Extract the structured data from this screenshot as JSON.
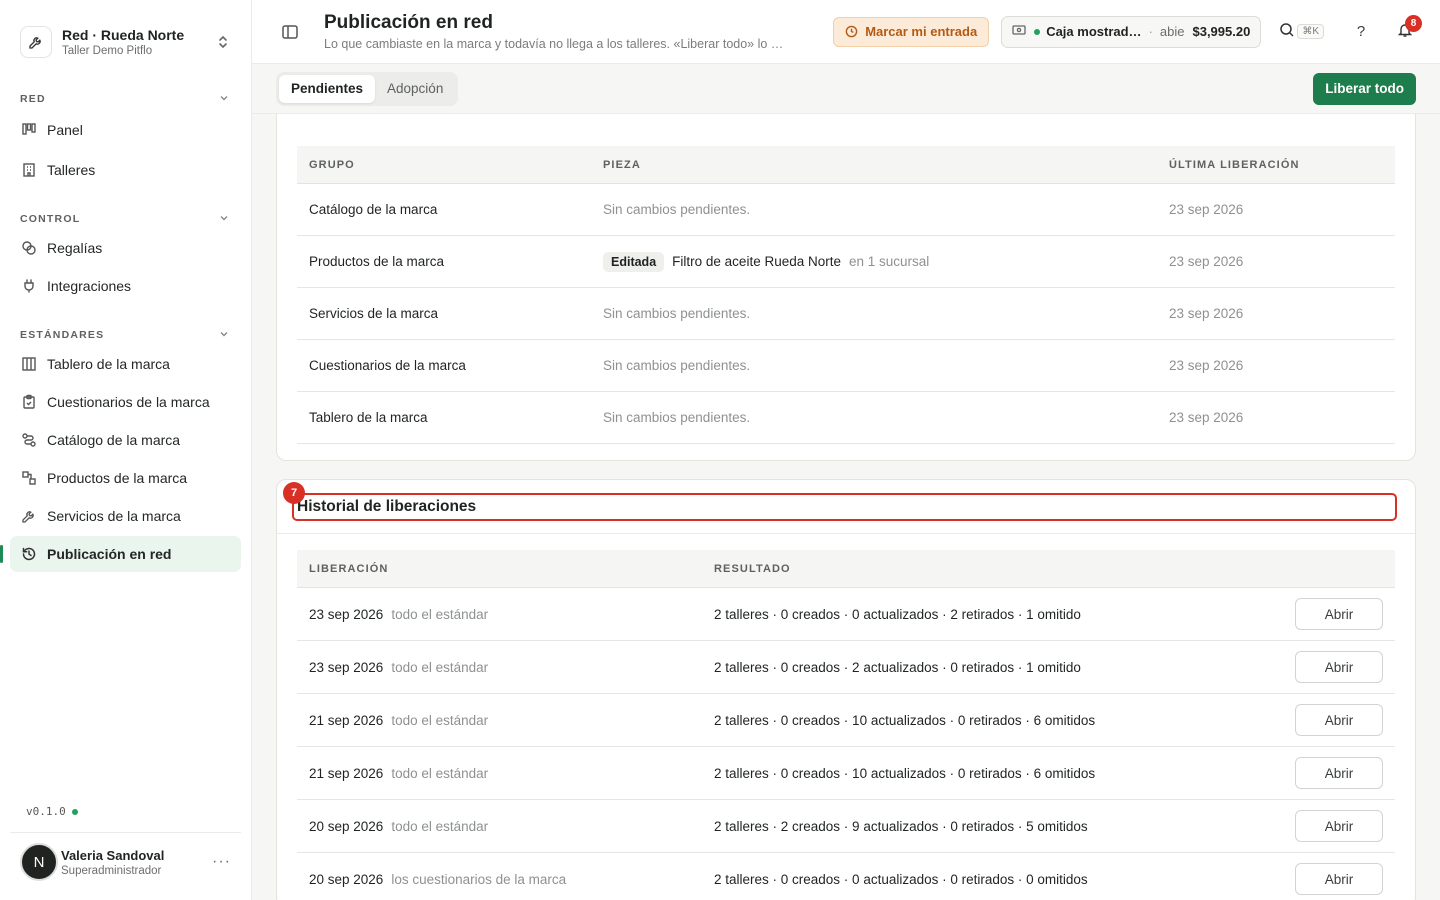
{
  "org": {
    "name": "Red · Rueda Norte",
    "subtitle": "Taller Demo Pitflo"
  },
  "sidebar": {
    "sections": [
      {
        "label": "RED",
        "items": [
          {
            "label": "Panel",
            "icon": "kanban-icon"
          },
          {
            "label": "Talleres",
            "icon": "building-icon"
          }
        ]
      },
      {
        "label": "CONTROL",
        "items": [
          {
            "label": "Regalías",
            "icon": "coins-icon"
          },
          {
            "label": "Integraciones",
            "icon": "plug-icon"
          }
        ]
      },
      {
        "label": "ESTÁNDARES",
        "items": [
          {
            "label": "Tablero de la marca",
            "icon": "columns-icon"
          },
          {
            "label": "Cuestionarios de la marca",
            "icon": "clipboard-icon"
          },
          {
            "label": "Catálogo de la marca",
            "icon": "route-icon"
          },
          {
            "label": "Productos de la marca",
            "icon": "boxes-icon"
          },
          {
            "label": "Servicios de la marca",
            "icon": "wrench-icon"
          },
          {
            "label": "Publicación en red",
            "icon": "history-icon",
            "active": true
          }
        ]
      }
    ],
    "version": "v0.1.0"
  },
  "user": {
    "initial": "N",
    "name": "Valeria Sandoval",
    "role": "Superadministrador"
  },
  "header": {
    "title": "Publicación en red",
    "subtitle": "Lo que cambiaste en la marca y todavía no llega a los talleres. «Liberar todo» lo …",
    "entry_button": "Marcar mi entrada",
    "cash": {
      "name": "Caja mostrad…",
      "state": "abie",
      "amount": "$3,995.20"
    },
    "shortcut": "⌘K",
    "help": "?",
    "notifications": "8"
  },
  "tabs": [
    {
      "label": "Pendientes",
      "active": true
    },
    {
      "label": "Adopción",
      "active": false
    }
  ],
  "primary_action": "Liberar todo",
  "pending": {
    "columns": [
      "GRUPO",
      "PIEZA",
      "ÚLTIMA LIBERACIÓN"
    ],
    "rows": [
      {
        "group": "Catálogo de la marca",
        "piece": "Sin cambios pendientes.",
        "date": "23 sep 2026"
      },
      {
        "group": "Productos de la marca",
        "chip": "Editada",
        "piece": "Filtro de aceite Rueda Norte",
        "piece_after": "en 1 sucursal",
        "date": "23 sep 2026"
      },
      {
        "group": "Servicios de la marca",
        "piece": "Sin cambios pendientes.",
        "date": "23 sep 2026"
      },
      {
        "group": "Cuestionarios de la marca",
        "piece": "Sin cambios pendientes.",
        "date": "23 sep 2026"
      },
      {
        "group": "Tablero de la marca",
        "piece": "Sin cambios pendientes.",
        "date": "23 sep 2026"
      }
    ]
  },
  "history": {
    "marker": "7",
    "title": "Historial de liberaciones",
    "columns": [
      "LIBERACIÓN",
      "RESULTADO"
    ],
    "open_label": "Abrir",
    "rows": [
      {
        "date": "23 sep 2026",
        "scope": "todo el estándar",
        "result": "2 talleres · 0 creados · 0 actualizados · 2 retirados · 1 omitido"
      },
      {
        "date": "23 sep 2026",
        "scope": "todo el estándar",
        "result": "2 talleres · 0 creados · 2 actualizados · 0 retirados · 1 omitido"
      },
      {
        "date": "21 sep 2026",
        "scope": "todo el estándar",
        "result": "2 talleres · 0 creados · 10 actualizados · 0 retirados · 6 omitidos"
      },
      {
        "date": "21 sep 2026",
        "scope": "todo el estándar",
        "result": "2 talleres · 0 creados · 10 actualizados · 0 retirados · 6 omitidos"
      },
      {
        "date": "20 sep 2026",
        "scope": "todo el estándar",
        "result": "2 talleres · 2 creados · 9 actualizados · 0 retirados · 5 omitidos"
      },
      {
        "date": "20 sep 2026",
        "scope": "los cuestionarios de la marca",
        "result": "2 talleres · 0 creados · 0 actualizados · 0 retirados · 0 omitidos"
      }
    ]
  },
  "colors": {
    "accent": "#1e7d4c",
    "danger": "#d93025",
    "warning_bg": "#fcebd9",
    "warning_text": "#b55a12"
  }
}
